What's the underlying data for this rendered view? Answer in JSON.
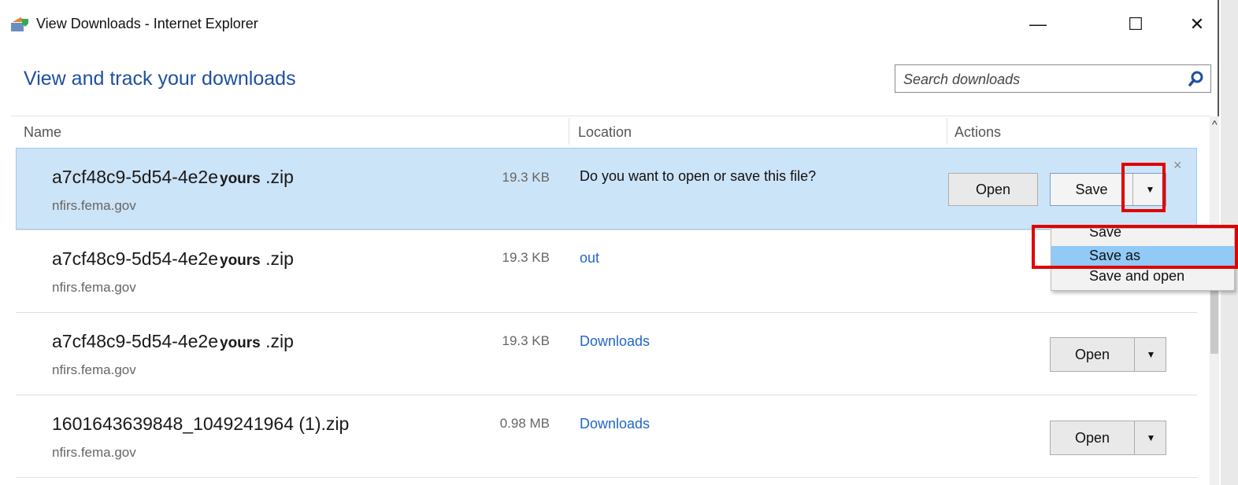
{
  "window": {
    "title": "View Downloads - Internet Explorer",
    "minimize_glyph": "—",
    "maximize_glyph": "☐",
    "close_glyph": "✕"
  },
  "page": {
    "heading": "View and track your downloads"
  },
  "search": {
    "placeholder": "Search downloads",
    "value": ""
  },
  "columns": {
    "name": "Name",
    "location": "Location",
    "actions": "Actions"
  },
  "downloads": [
    {
      "name": "a7cf48c9-5d54-4e2e",
      "name_tag": "yours",
      "ext": " .zip",
      "source": "nfirs.fema.gov",
      "size": "19.3 KB",
      "location": "Do you want to open or save this file?",
      "primary_button": "Open",
      "secondary_button": "Save"
    },
    {
      "name": "a7cf48c9-5d54-4e2e",
      "name_tag": "yours",
      "ext": " .zip",
      "source": "nfirs.fema.gov",
      "size": "19.3 KB",
      "location": "out"
    },
    {
      "name": "a7cf48c9-5d54-4e2e",
      "name_tag": "yours",
      "ext": " .zip",
      "source": "nfirs.fema.gov",
      "size": "19.3 KB",
      "location": "Downloads",
      "primary_button": "Open"
    },
    {
      "name": "1601643639848_1049241964 (1).zip",
      "name_tag": "",
      "ext": "",
      "source": "nfirs.fema.gov",
      "size": "0.98 MB",
      "location": "Downloads",
      "primary_button": "Open"
    }
  ],
  "save_menu": {
    "items": [
      "Save",
      "Save as",
      "Save and open"
    ],
    "highlighted": "Save as"
  },
  "icons": {
    "app": "ie-downloads-icon",
    "search": "search-icon",
    "dropdown": "chevron-down-icon",
    "close": "close-icon",
    "scroll_up": "scroll-up-arrow-icon"
  },
  "colors": {
    "heading": "#1f4fa0",
    "link": "#1f66c7",
    "selection": "#cce4f7",
    "menu_highlight": "#91c9f7",
    "annotation": "#e00000"
  },
  "dismiss_glyph": "×",
  "dropdown_glyph": "▼",
  "scroll_glyph": "^"
}
